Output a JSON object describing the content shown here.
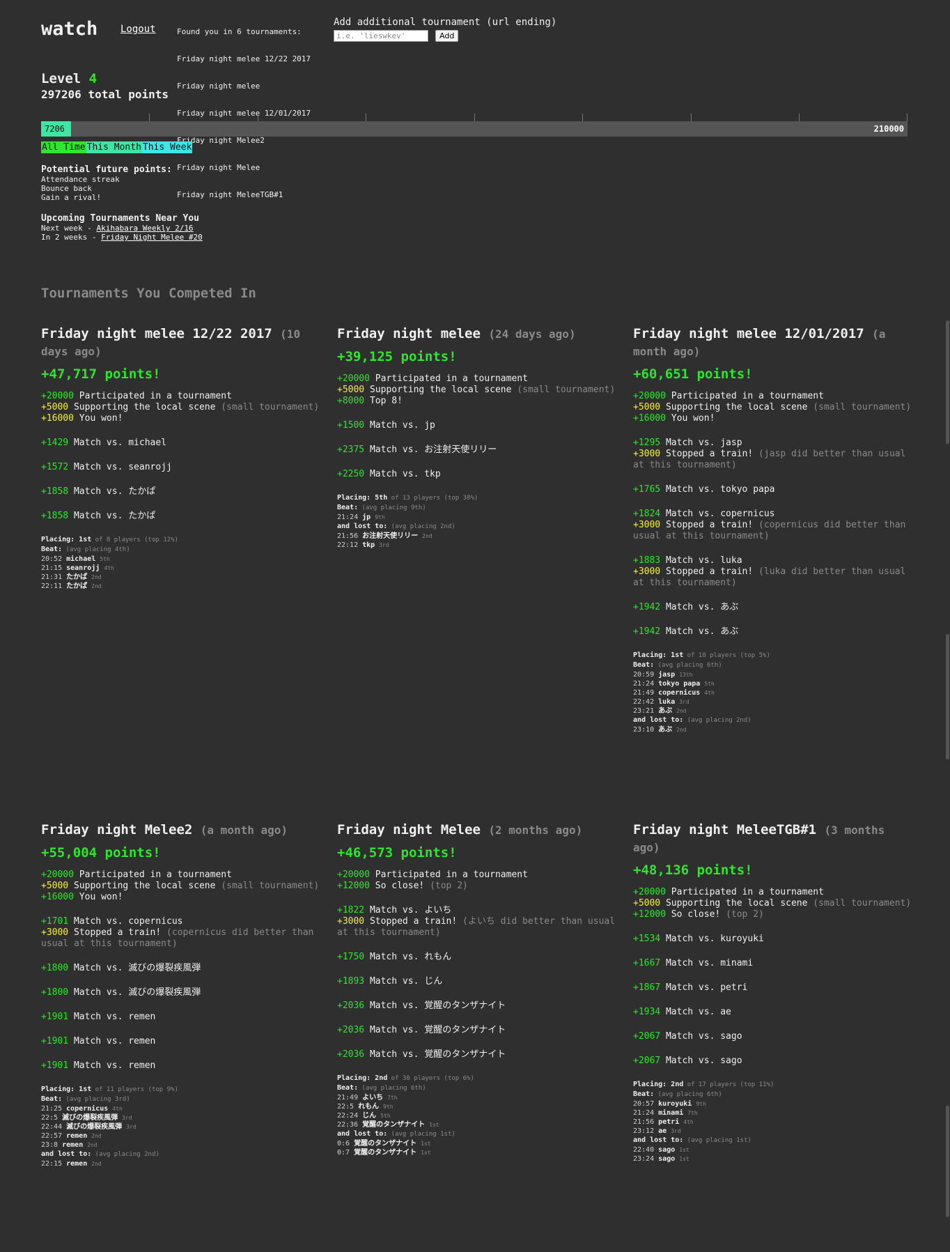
{
  "header": {
    "logo": "watch",
    "logout": "Logout",
    "found_title": "Found you in 6 tournaments:",
    "found_list": [
      "Friday night melee 12/22 2017",
      "Friday night melee",
      "Friday night melee 12/01/2017",
      "Friday night Melee2",
      "Friday night Melee",
      "Friday night MeleeTGB#1"
    ],
    "add_label": "Add additional tournament (url ending)",
    "add_placeholder": "i.e. 'lieswkev'",
    "add_button": "Add"
  },
  "level": {
    "label": "Level",
    "value": "4",
    "total": "297206 total points"
  },
  "progress": {
    "current": "7206",
    "max": "210000",
    "fraction": 0.0343
  },
  "tabs": [
    "All Time",
    "This Month",
    "This Week"
  ],
  "future": {
    "title": "Potential future points:",
    "items": [
      "Attendance streak",
      "Bounce back",
      "Gain a rival!"
    ]
  },
  "upcoming": {
    "title": "Upcoming Tournaments Near You",
    "items": [
      {
        "when": "Next week - ",
        "name": "Akihabara Weekly 2/16"
      },
      {
        "when": "In 2 weeks - ",
        "name": "Friday Night Melee #20"
      }
    ]
  },
  "competed_title": "Tournaments You Competed In",
  "tournaments": [
    {
      "title": "Friday night melee 12/22 2017",
      "ago": "(10 days ago)",
      "points": "+47,717 points!",
      "groups": [
        [
          {
            "pts": "+20000",
            "c": "green",
            "text": "Participated in a tournament",
            "note": ""
          },
          {
            "pts": "+5000",
            "c": "yellow",
            "text": "Supporting the local scene",
            "note": "(small tournament)"
          },
          {
            "pts": "+16000",
            "c": "yellow",
            "text": "You won!",
            "note": ""
          }
        ],
        [
          {
            "pts": "+1429",
            "c": "green",
            "text": "Match vs. michael",
            "note": ""
          }
        ],
        [
          {
            "pts": "+1572",
            "c": "green",
            "text": "Match vs. seanrojj",
            "note": ""
          }
        ],
        [
          {
            "pts": "+1858",
            "c": "green",
            "text": "Match vs. たかぱ",
            "note": ""
          }
        ],
        [
          {
            "pts": "+1858",
            "c": "green",
            "text": "Match vs. たかぱ",
            "note": ""
          }
        ]
      ],
      "placing": "1st",
      "placing_sub": "of 8 players (top 12%)",
      "beat_sub": "(avg placing 4th)",
      "beat": [
        [
          "20:52",
          "michael",
          "5th"
        ],
        [
          "21:15",
          "seanrojj",
          "4th"
        ],
        [
          "21:31",
          "たかぱ",
          "2nd"
        ],
        [
          "22:11",
          "たかぱ",
          "2nd"
        ]
      ],
      "lost_sub": "",
      "lost": []
    },
    {
      "title": "Friday night melee",
      "ago": "(24 days ago)",
      "points": "+39,125 points!",
      "groups": [
        [
          {
            "pts": "+20000",
            "c": "green",
            "text": "Participated in a tournament",
            "note": ""
          },
          {
            "pts": "+5000",
            "c": "yellow",
            "text": "Supporting the local scene",
            "note": "(small tournament)"
          },
          {
            "pts": "+8000",
            "c": "green",
            "text": "Top 8!",
            "note": ""
          }
        ],
        [
          {
            "pts": "+1500",
            "c": "green",
            "text": "Match vs. jp",
            "note": ""
          }
        ],
        [
          {
            "pts": "+2375",
            "c": "green",
            "text": "Match vs. お注射天使リリー",
            "note": ""
          }
        ],
        [
          {
            "pts": "+2250",
            "c": "green",
            "text": "Match vs. tkp",
            "note": ""
          }
        ]
      ],
      "placing": "5th",
      "placing_sub": "of 13 players (top 38%)",
      "beat_sub": "(avg placing 9th)",
      "beat": [
        [
          "21:24",
          "jp",
          "9th"
        ]
      ],
      "lost_sub": "(avg placing 2nd)",
      "lost": [
        [
          "21:56",
          "お注射天使リリー",
          "2nd"
        ],
        [
          "22:12",
          "tkp",
          "3rd"
        ]
      ]
    },
    {
      "title": "Friday night melee 12/01/2017",
      "ago": "(a month ago)",
      "points": "+60,651 points!",
      "groups": [
        [
          {
            "pts": "+20000",
            "c": "green",
            "text": "Participated in a tournament",
            "note": ""
          },
          {
            "pts": "+5000",
            "c": "yellow",
            "text": "Supporting the local scene",
            "note": "(small tournament)"
          },
          {
            "pts": "+16000",
            "c": "green",
            "text": "You won!",
            "note": ""
          }
        ],
        [
          {
            "pts": "+1295",
            "c": "green",
            "text": "Match vs. jasp",
            "note": ""
          },
          {
            "pts": "+3000",
            "c": "yellow",
            "text": "Stopped a train!",
            "note": "(jasp did better than usual at this tournament)"
          }
        ],
        [
          {
            "pts": "+1765",
            "c": "green",
            "text": "Match vs. tokyo papa",
            "note": ""
          }
        ],
        [
          {
            "pts": "+1824",
            "c": "green",
            "text": "Match vs. copernicus",
            "note": ""
          },
          {
            "pts": "+3000",
            "c": "yellow",
            "text": "Stopped a train!",
            "note": "(copernicus did better than usual at this tournament)"
          }
        ],
        [
          {
            "pts": "+1883",
            "c": "green",
            "text": "Match vs. luka",
            "note": ""
          },
          {
            "pts": "+3000",
            "c": "yellow",
            "text": "Stopped a train!",
            "note": "(luka did better than usual at this tournament)"
          }
        ],
        [
          {
            "pts": "+1942",
            "c": "green",
            "text": "Match vs. あぶ",
            "note": ""
          }
        ],
        [
          {
            "pts": "+1942",
            "c": "green",
            "text": "Match vs. あぶ",
            "note": ""
          }
        ]
      ],
      "placing": "1st",
      "placing_sub": "of 18 players (top 5%)",
      "beat_sub": "(avg placing 6th)",
      "beat": [
        [
          "20:59",
          "jasp",
          "13th"
        ],
        [
          "21:24",
          "tokyo papa",
          "5th"
        ],
        [
          "21:49",
          "copernicus",
          "4th"
        ],
        [
          "22:42",
          "luka",
          "3rd"
        ],
        [
          "23:21",
          "あぶ",
          "2nd"
        ]
      ],
      "lost_sub": "(avg placing 2nd)",
      "lost": [
        [
          "23:10",
          "あぶ",
          "2nd"
        ]
      ]
    },
    {
      "title": "Friday night Melee2",
      "ago": "(a month ago)",
      "points": "+55,004 points!",
      "groups": [
        [
          {
            "pts": "+20000",
            "c": "green",
            "text": "Participated in a tournament",
            "note": ""
          },
          {
            "pts": "+5000",
            "c": "yellow",
            "text": "Supporting the local scene",
            "note": "(small tournament)"
          },
          {
            "pts": "+16000",
            "c": "green",
            "text": "You won!",
            "note": ""
          }
        ],
        [
          {
            "pts": "+1701",
            "c": "green",
            "text": "Match vs. copernicus",
            "note": ""
          },
          {
            "pts": "+3000",
            "c": "yellow",
            "text": "Stopped a train!",
            "note": "(copernicus did better than usual at this tournament)"
          }
        ],
        [
          {
            "pts": "+1800",
            "c": "green",
            "text": "Match vs. 滅びの爆裂疾風弾",
            "note": ""
          }
        ],
        [
          {
            "pts": "+1800",
            "c": "green",
            "text": "Match vs. 滅びの爆裂疾風弾",
            "note": ""
          }
        ],
        [
          {
            "pts": "+1901",
            "c": "green",
            "text": "Match vs. remen",
            "note": ""
          }
        ],
        [
          {
            "pts": "+1901",
            "c": "green",
            "text": "Match vs. remen",
            "note": ""
          }
        ],
        [
          {
            "pts": "+1901",
            "c": "green",
            "text": "Match vs. remen",
            "note": ""
          }
        ]
      ],
      "placing": "1st",
      "placing_sub": "of 11 players (top 9%)",
      "beat_sub": "(avg placing 3rd)",
      "beat": [
        [
          "21:25",
          "copernicus",
          "4th"
        ],
        [
          "22:5",
          "滅びの爆裂疾風弾",
          "3rd"
        ],
        [
          "22:44",
          "滅びの爆裂疾風弾",
          "3rd"
        ],
        [
          "22:57",
          "remen",
          "2nd"
        ],
        [
          "23:8",
          "remen",
          "2nd"
        ]
      ],
      "lost_sub": "(avg placing 2nd)",
      "lost": [
        [
          "22:15",
          "remen",
          "2nd"
        ]
      ]
    },
    {
      "title": "Friday night Melee",
      "ago": "(2 months ago)",
      "points": "+46,573 points!",
      "groups": [
        [
          {
            "pts": "+20000",
            "c": "green",
            "text": "Participated in a tournament",
            "note": ""
          },
          {
            "pts": "+12000",
            "c": "green",
            "text": "So close!",
            "note": "(top 2)"
          }
        ],
        [
          {
            "pts": "+1822",
            "c": "green",
            "text": "Match vs. よいち",
            "note": ""
          },
          {
            "pts": "+3000",
            "c": "yellow",
            "text": "Stopped a train!",
            "note": "(よいち did better than usual at this tournament)"
          }
        ],
        [
          {
            "pts": "+1750",
            "c": "green",
            "text": "Match vs. れもん",
            "note": ""
          }
        ],
        [
          {
            "pts": "+1893",
            "c": "green",
            "text": "Match vs. じん",
            "note": ""
          }
        ],
        [
          {
            "pts": "+2036",
            "c": "green",
            "text": "Match vs. 覚醒のタンザナイト",
            "note": ""
          }
        ],
        [
          {
            "pts": "+2036",
            "c": "green",
            "text": "Match vs. 覚醒のタンザナイト",
            "note": ""
          }
        ],
        [
          {
            "pts": "+2036",
            "c": "green",
            "text": "Match vs. 覚醒のタンザナイト",
            "note": ""
          }
        ]
      ],
      "placing": "2nd",
      "placing_sub": "of 30 players (top 6%)",
      "beat_sub": "(avg placing 6th)",
      "beat": [
        [
          "21:49",
          "よいち",
          "7th"
        ],
        [
          "22:5",
          "れもん",
          "9th"
        ],
        [
          "22:24",
          "じん",
          "5th"
        ],
        [
          "22:36",
          "覚醒のタンザナイト",
          "1st"
        ]
      ],
      "lost_sub": "(avg placing 1st)",
      "lost": [
        [
          "0:6",
          "覚醒のタンザナイト",
          "1st"
        ],
        [
          "0:7",
          "覚醒のタンザナイト",
          "1st"
        ]
      ]
    },
    {
      "title": "Friday night MeleeTGB#1",
      "ago": "(3 months ago)",
      "points": "+48,136 points!",
      "groups": [
        [
          {
            "pts": "+20000",
            "c": "green",
            "text": "Participated in a tournament",
            "note": ""
          },
          {
            "pts": "+5000",
            "c": "yellow",
            "text": "Supporting the local scene",
            "note": "(small tournament)"
          },
          {
            "pts": "+12000",
            "c": "green",
            "text": "So close!",
            "note": "(top 2)"
          }
        ],
        [
          {
            "pts": "+1534",
            "c": "green",
            "text": "Match vs. kuroyuki",
            "note": ""
          }
        ],
        [
          {
            "pts": "+1667",
            "c": "green",
            "text": "Match vs. minami",
            "note": ""
          }
        ],
        [
          {
            "pts": "+1867",
            "c": "green",
            "text": "Match vs. petri",
            "note": ""
          }
        ],
        [
          {
            "pts": "+1934",
            "c": "green",
            "text": "Match vs. ae",
            "note": ""
          }
        ],
        [
          {
            "pts": "+2067",
            "c": "green",
            "text": "Match vs. sago",
            "note": ""
          }
        ],
        [
          {
            "pts": "+2067",
            "c": "green",
            "text": "Match vs. sago",
            "note": ""
          }
        ]
      ],
      "placing": "2nd",
      "placing_sub": "of 17 players (top 11%)",
      "beat_sub": "(avg placing 6th)",
      "beat": [
        [
          "20:57",
          "kuroyuki",
          "9th"
        ],
        [
          "21:24",
          "minami",
          "7th"
        ],
        [
          "21:56",
          "petri",
          "4th"
        ],
        [
          "23:12",
          "ae",
          "3rd"
        ]
      ],
      "lost_sub": "(avg placing 1st)",
      "lost": [
        [
          "22:40",
          "sago",
          "1st"
        ],
        [
          "23:24",
          "sago",
          "1st"
        ]
      ]
    }
  ]
}
